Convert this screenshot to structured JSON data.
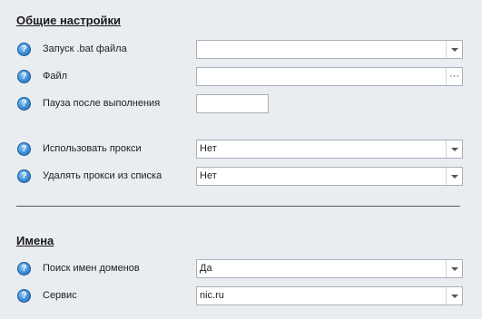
{
  "sections": {
    "general": "Общие настройки",
    "names": "Имена"
  },
  "fields": {
    "bat_launch": {
      "label": "Запуск .bat файла",
      "value": ""
    },
    "file": {
      "label": "Файл",
      "value": "",
      "browse": "···"
    },
    "pause": {
      "label": "Пауза после выполнения",
      "value": ""
    },
    "use_proxy": {
      "label": "Использовать прокси",
      "value": "Нет"
    },
    "remove_proxy": {
      "label": "Удалять прокси из списка",
      "value": "Нет"
    },
    "domain_search": {
      "label": "Поиск имен доменов",
      "value": "Да"
    },
    "service": {
      "label": "Сервис",
      "value": "nic.ru"
    }
  },
  "icons": {
    "help": "help-question-icon",
    "dropdown": "chevron-down-icon",
    "browse": "ellipsis-icon"
  },
  "colors": {
    "background": "#e9ecf0",
    "help_icon": "#3d8fd6"
  }
}
